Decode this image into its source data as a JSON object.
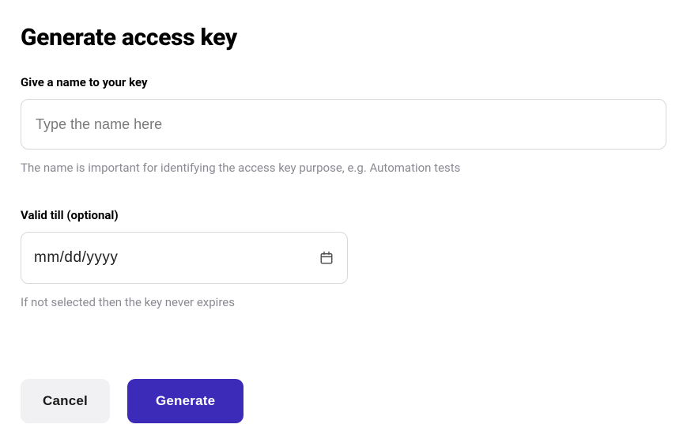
{
  "dialog": {
    "title": "Generate access key",
    "name_field": {
      "label": "Give a name to your key",
      "placeholder": "Type the name here",
      "value": "",
      "help": "The name is important for identifying the access key purpose, e.g. Automation tests"
    },
    "valid_till_field": {
      "label": "Valid till (optional)",
      "value": "mm/dd/yyyy",
      "help": "If not selected then the key never expires"
    },
    "buttons": {
      "cancel": "Cancel",
      "generate": "Generate"
    }
  },
  "colors": {
    "primary": "#3c2ab8",
    "muted_text": "#8a8a93",
    "secondary_bg": "#f1f1f3"
  }
}
